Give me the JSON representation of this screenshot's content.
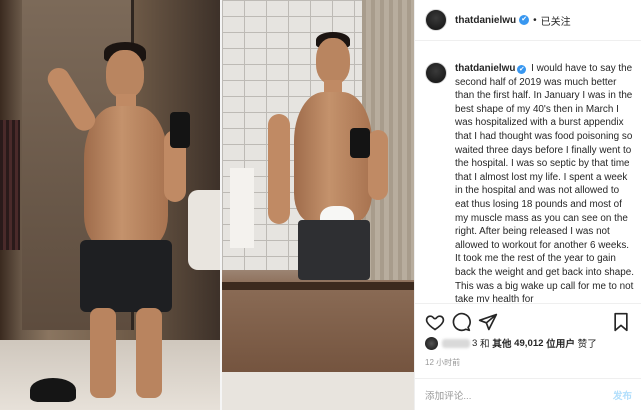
{
  "header": {
    "username": "thatdaniel­wu",
    "verified_mark": "✔",
    "separator": "•",
    "follow_label": "已关注"
  },
  "caption": {
    "username": "thatdanielwu",
    "verified_mark": "✔",
    "text": "I would have to say the second half of 2019 was much better than the first half. In January I was in the best shape of my 40's then in March I was hospitalized with a burst appendix that I had thought was food poisoning so waited three days before I finally went to the hospital. I was so septic by that time that I almost lost my life. I spent a week in the hospital and was not allowed to eat thus losing 18 pounds and most of my muscle mass as you can see on the right. After being released I was not allowed to workout for another 6 weeks. It took me the rest of the year to gain back the weight and get back into shape. This was a big wake up call for me to not take my health for"
  },
  "actions": {
    "like_icon": "heart-icon",
    "comment_icon": "comment-bubble-icon",
    "share_icon": "paper-plane-icon",
    "save_icon": "bookmark-icon"
  },
  "likes": {
    "suffix_1": "3",
    "and_label": "和",
    "others_label": "其他",
    "count": "49,012",
    "users_label": "位用户",
    "liked_label": "赞了"
  },
  "timestamp": "12 小时前",
  "comment_box": {
    "placeholder": "添加评论...",
    "post_label": "发布"
  },
  "colors": {
    "verified": "#3897f0",
    "post_button": "#b2dffc",
    "muted_text": "#999999",
    "border": "#efefef"
  }
}
